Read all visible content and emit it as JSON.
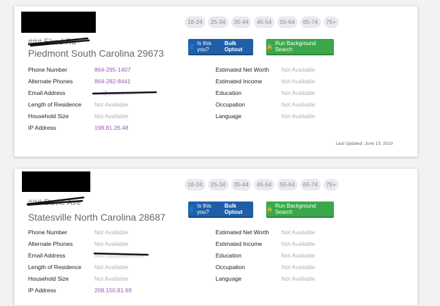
{
  "age_ranges": [
    "18-24",
    "25-34",
    "35-44",
    "45-54",
    "55-64",
    "65-74",
    "75+"
  ],
  "buttons": {
    "optout_prefix": "Is this you?",
    "optout_bold": "Bulk Optout",
    "background": "Run Background Search"
  },
  "cards": [
    {
      "street": "### Elrod Rd",
      "city_state_zip": "Piedmont South Carolina 29673",
      "left_fields": [
        {
          "label": "Phone Number",
          "value": "864-295-1407",
          "link": true
        },
        {
          "label": "Alternate Phones",
          "value": "864-282-8441",
          "link": true
        },
        {
          "label": "Email Address",
          "value": "r....@yahoo.com",
          "link": true
        },
        {
          "label": "Length of Residence",
          "value": "Not Available",
          "link": false
        },
        {
          "label": "Household Size",
          "value": "Not Available",
          "link": false
        },
        {
          "label": "IP Address",
          "value": "198.81.26.48",
          "link": true
        }
      ],
      "right_fields": [
        {
          "label": "Estimated Net Worth",
          "value": "Not Available"
        },
        {
          "label": "Estimated Income",
          "value": "Not Available"
        },
        {
          "label": "Education",
          "value": "Not Available"
        },
        {
          "label": "Occupation",
          "value": "Not Available"
        },
        {
          "label": "Language",
          "value": "Not Available"
        }
      ],
      "last_updated": "Last Updated: June 13, 2019"
    },
    {
      "street": "### Davie Ave",
      "city_state_zip": "Statesville North Carolina 28687",
      "left_fields": [
        {
          "label": "Phone Number",
          "value": "Not Available",
          "link": false
        },
        {
          "label": "Alternate Phones",
          "value": "Not Available",
          "link": false
        },
        {
          "label": "Email Address",
          "value": "fvl075@yahoo.com",
          "link": true
        },
        {
          "label": "Length of Residence",
          "value": "Not Available",
          "link": false
        },
        {
          "label": "Household Size",
          "value": "Not Available",
          "link": false
        },
        {
          "label": "IP Address",
          "value": "208.150.81.69",
          "link": true
        }
      ],
      "right_fields": [
        {
          "label": "Estimated Net Worth",
          "value": "Not Available"
        },
        {
          "label": "Estimated Income",
          "value": "Not Available"
        },
        {
          "label": "Education",
          "value": "Not Available"
        },
        {
          "label": "Occupation",
          "value": "Not Available"
        },
        {
          "label": "Language",
          "value": "Not Available"
        }
      ]
    }
  ]
}
